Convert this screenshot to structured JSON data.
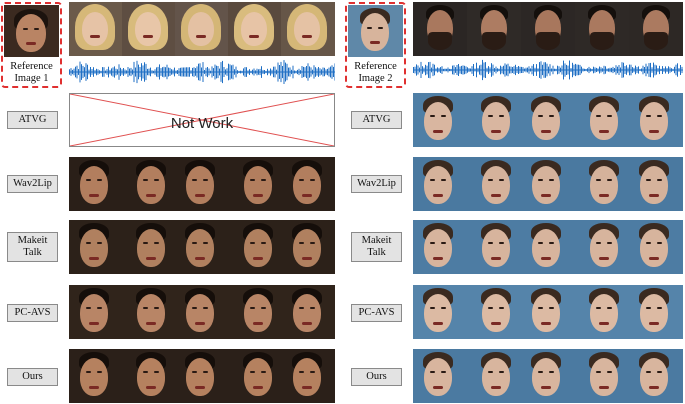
{
  "reference_1": {
    "label_line1": "Reference",
    "label_line2": "Image 1"
  },
  "reference_2": {
    "label_line1": "Reference",
    "label_line2": "Image 2"
  },
  "methods": [
    {
      "id": "atvg",
      "label": "ATVG"
    },
    {
      "id": "wav2lip",
      "label": "Wav2Lip"
    },
    {
      "id": "makeit",
      "label_line1": "Makeit",
      "label_line2": "Talk"
    },
    {
      "id": "pcavs",
      "label": "PC-AVS"
    },
    {
      "id": "ours",
      "label": "Ours"
    }
  ],
  "left_panel": {
    "atvg_placeholder": "Not Work"
  },
  "colors": {
    "dashed_border": "#e03030",
    "waveform": "#1f6fc4",
    "placeholder_cross": "#e05050"
  }
}
